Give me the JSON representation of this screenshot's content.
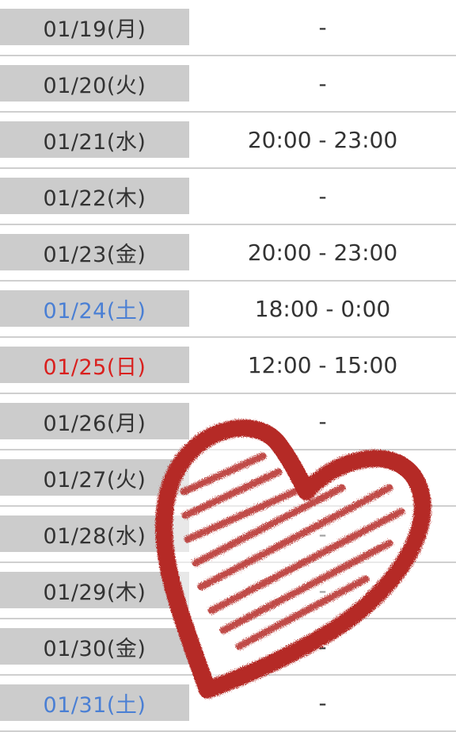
{
  "schedule": {
    "rows": [
      {
        "date": "01/19(月)",
        "time": "-",
        "day_type": "weekday"
      },
      {
        "date": "01/20(火)",
        "time": "-",
        "day_type": "weekday"
      },
      {
        "date": "01/21(水)",
        "time": "20:00 - 23:00",
        "day_type": "weekday"
      },
      {
        "date": "01/22(木)",
        "time": "-",
        "day_type": "weekday"
      },
      {
        "date": "01/23(金)",
        "time": "20:00 - 23:00",
        "day_type": "weekday"
      },
      {
        "date": "01/24(土)",
        "time": "18:00 - 0:00",
        "day_type": "saturday"
      },
      {
        "date": "01/25(日)",
        "time": "12:00 - 15:00",
        "day_type": "sunday"
      },
      {
        "date": "01/26(月)",
        "time": "-",
        "day_type": "weekday"
      },
      {
        "date": "01/27(火)",
        "time": "-",
        "day_type": "weekday"
      },
      {
        "date": "01/28(水)",
        "time": "-",
        "day_type": "weekday"
      },
      {
        "date": "01/29(木)",
        "time": "-",
        "day_type": "weekday"
      },
      {
        "date": "01/30(金)",
        "time": "-",
        "day_type": "weekday"
      },
      {
        "date": "01/31(土)",
        "time": "-",
        "day_type": "saturday"
      }
    ]
  },
  "colors": {
    "date_cell_bg": "#cccccc",
    "text": "#333333",
    "saturday": "#4a7fd4",
    "sunday": "#d9201e",
    "heart": "#b52a26"
  },
  "overlay": {
    "icon": "heart-stamp-icon"
  }
}
